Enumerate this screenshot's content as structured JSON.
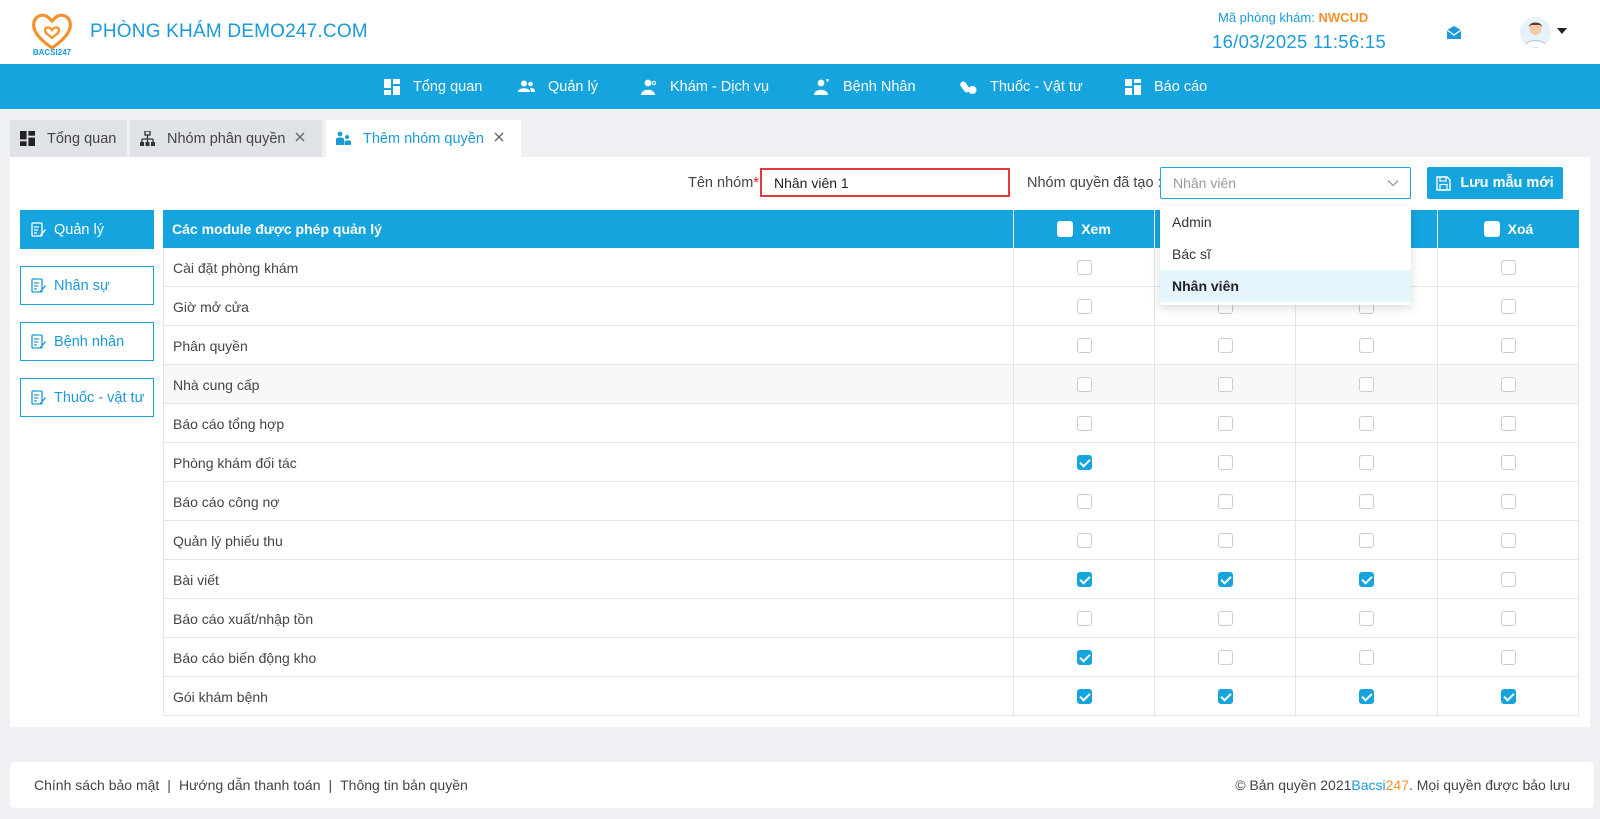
{
  "header": {
    "clinic_name": "PHÒNG KHÁM DEMO247.COM",
    "logo_text": "BACSI247",
    "code_label": "Mã phòng khám:",
    "code_value": "NWCUD",
    "datetime": "16/03/2025 11:56:15"
  },
  "nav": [
    {
      "label": "Tổng quan",
      "icon": "dashboard-icon"
    },
    {
      "label": "Quản lý",
      "icon": "users-icon"
    },
    {
      "label": "Khám - Dịch vụ",
      "icon": "doctor-icon"
    },
    {
      "label": "Bệnh Nhân",
      "icon": "patient-icon"
    },
    {
      "label": "Thuốc - Vật tư",
      "icon": "pills-icon"
    },
    {
      "label": "Báo cáo",
      "icon": "report-icon"
    }
  ],
  "tabs": [
    {
      "label": "Tổng quan",
      "closable": false,
      "active": false
    },
    {
      "label": "Nhóm phân quyền",
      "closable": true,
      "active": false
    },
    {
      "label": "Thêm nhóm quyền",
      "closable": true,
      "active": true
    }
  ],
  "form": {
    "name_label": "Tên nhóm",
    "required_mark": "*",
    "name_value": "Nhân viên 1",
    "group_label": "Nhóm quyền đã tạo :",
    "group_placeholder": "Nhân viên",
    "save_label": "Lưu mẫu mới"
  },
  "dropdown": {
    "options": [
      "Admin",
      "Bác sĩ",
      "Nhân viên"
    ],
    "selected": "Nhân viên"
  },
  "sidebar": {
    "items": [
      {
        "label": "Quản lý",
        "active": true
      },
      {
        "label": "Nhân sự",
        "active": false
      },
      {
        "label": "Bệnh nhân",
        "active": false
      },
      {
        "label": "Thuốc - vật tư",
        "active": false
      }
    ]
  },
  "table": {
    "module_header": "Các module được phép quản lý",
    "col_headers": [
      "Xem",
      "",
      "",
      "Xoá"
    ],
    "rows": [
      {
        "name": "Cài đặt phòng khám",
        "perms": [
          false,
          false,
          false,
          false
        ]
      },
      {
        "name": "Giờ mở cửa",
        "perms": [
          false,
          false,
          false,
          false
        ]
      },
      {
        "name": "Phân quyền",
        "perms": [
          false,
          false,
          false,
          false
        ]
      },
      {
        "name": "Nhà cung cấp",
        "perms": [
          false,
          false,
          false,
          false
        ]
      },
      {
        "name": "Báo cáo tổng hợp",
        "perms": [
          false,
          false,
          false,
          false
        ]
      },
      {
        "name": "Phòng khám đối tác",
        "perms": [
          true,
          false,
          false,
          false
        ]
      },
      {
        "name": "Báo cáo công nợ",
        "perms": [
          false,
          false,
          false,
          false
        ]
      },
      {
        "name": "Quản lý phiếu thu",
        "perms": [
          false,
          false,
          false,
          false
        ]
      },
      {
        "name": "Bài viết",
        "perms": [
          true,
          true,
          true,
          false
        ]
      },
      {
        "name": "Báo cáo xuất/nhập tồn",
        "perms": [
          false,
          false,
          false,
          false
        ]
      },
      {
        "name": "Báo cáo biến động kho",
        "perms": [
          true,
          false,
          false,
          false
        ]
      },
      {
        "name": "Gói khám bệnh",
        "perms": [
          true,
          true,
          true,
          true
        ]
      }
    ]
  },
  "footer": {
    "links": [
      "Chính sách bảo mật",
      "Hướng dẫn thanh toán",
      "Thông tin bản quyền"
    ],
    "separator": "|",
    "copyright_prefix": "© Bản quyền 2021",
    "brand_part1": "Bacsi",
    "brand_part2": "247",
    "copyright_suffix": ". Mọi quyền được bảo lưu"
  },
  "colors": {
    "primary": "#16a4df",
    "accent": "#f5912b",
    "required": "#e23a3a"
  }
}
